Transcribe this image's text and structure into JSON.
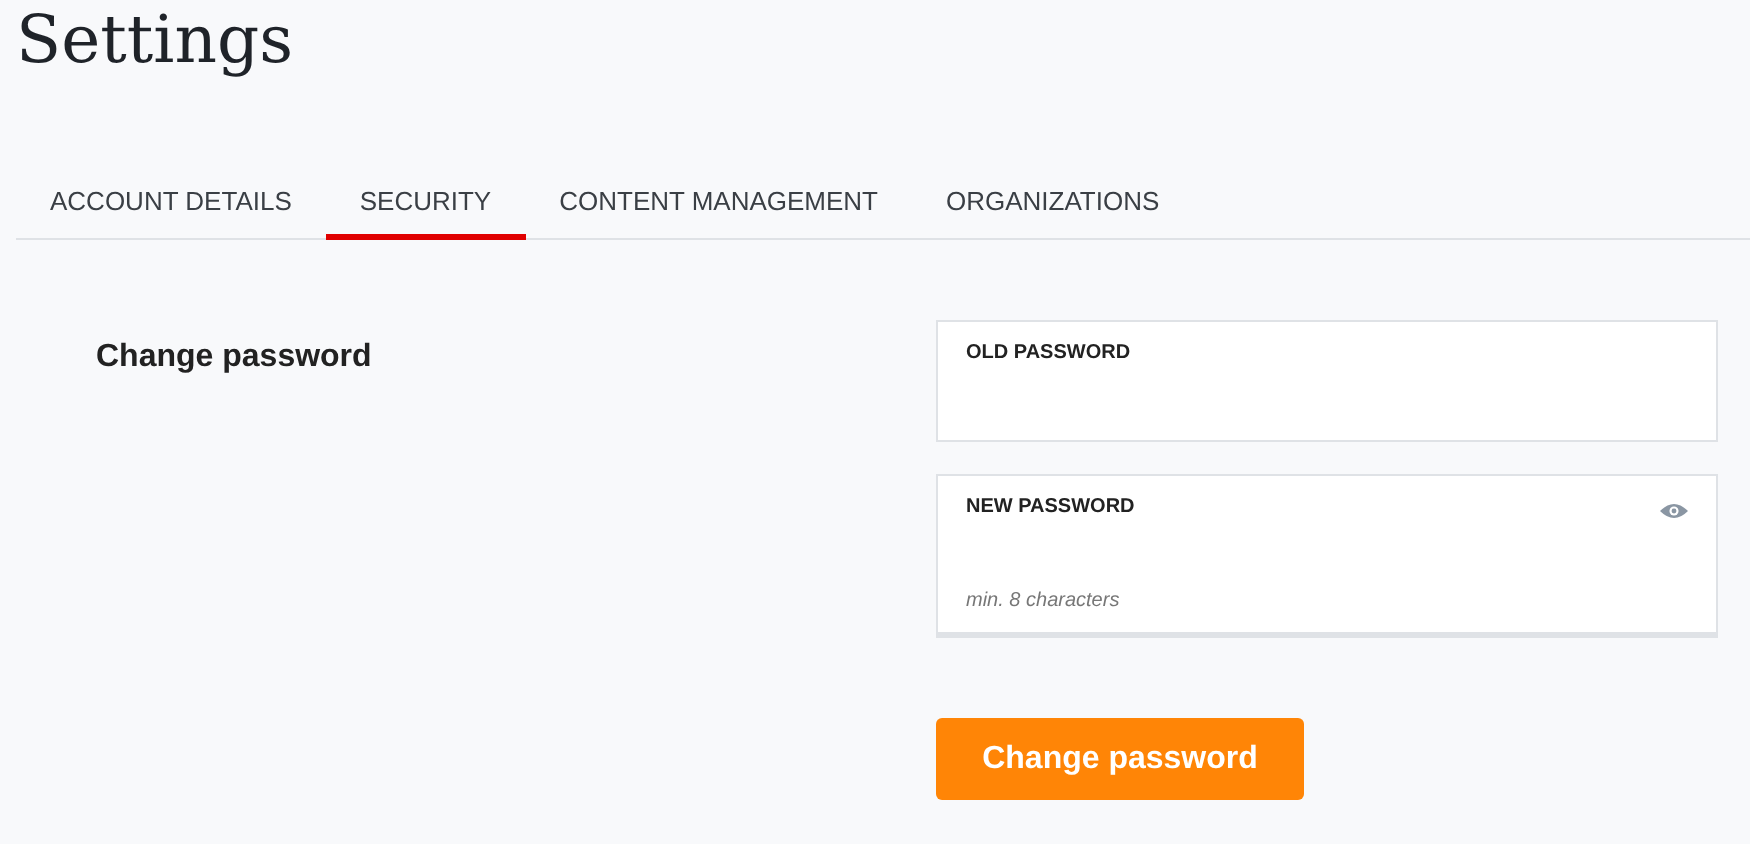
{
  "page": {
    "title": "Settings"
  },
  "tabs": [
    {
      "label": "ACCOUNT DETAILS",
      "selected": false
    },
    {
      "label": "SECURITY",
      "selected": true
    },
    {
      "label": "CONTENT MANAGEMENT",
      "selected": false
    },
    {
      "label": "ORGANIZATIONS",
      "selected": false
    }
  ],
  "section": {
    "title": "Change password"
  },
  "fields": [
    {
      "label": "OLD PASSWORD",
      "show_toggle": false
    },
    {
      "label": "NEW PASSWORD",
      "show_toggle": true,
      "hint": "min. 8 characters"
    }
  ],
  "submit_button": {
    "label": "Change password"
  }
}
